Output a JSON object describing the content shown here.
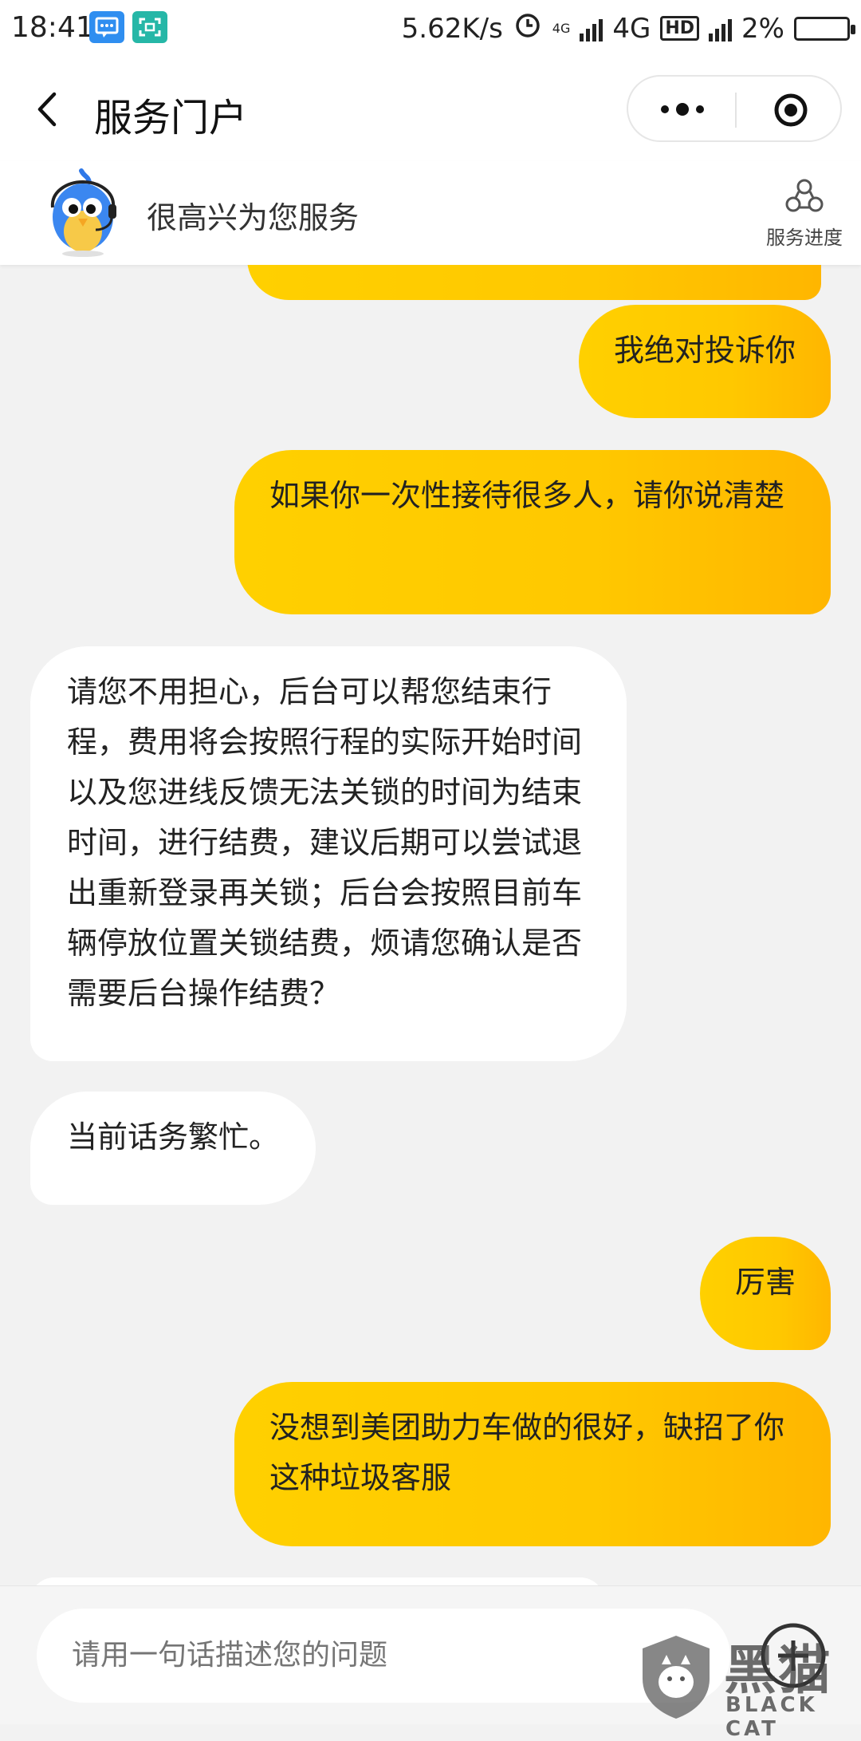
{
  "status_bar": {
    "time": "18:41",
    "speed": "5.62K/s",
    "network_small": "4G",
    "network": "4G",
    "hd": "HD",
    "battery": "2%"
  },
  "titlebar": {
    "title": "服务门户"
  },
  "header": {
    "greeting": "很高兴为您服务",
    "progress_label": "服务进度"
  },
  "messages": [
    {
      "role": "user",
      "text": "我绝对投诉你"
    },
    {
      "role": "user",
      "text": "如果你一次性接待很多人，请你说清楚"
    },
    {
      "role": "agent",
      "text": "请您不用担心，后台可以帮您结束行程，费用将会按照行程的实际开始时间以及您进线反馈无法关锁的时间为结束时间，进行结费，建议后期可以尝试退出重新登录再关锁；后台会按照目前车辆停放位置关锁结费，烦请您确认是否需要后台操作结费？"
    },
    {
      "role": "agent",
      "text": "当前话务繁忙。"
    },
    {
      "role": "user",
      "text": "厉害"
    },
    {
      "role": "user",
      "text": "没想到美团助力车做的很好，缺招了你这种垃圾客服"
    }
  ],
  "input": {
    "placeholder": "请用一句话描述您的问题"
  },
  "watermark": {
    "cn": "黑猫",
    "en": "BLACK CAT"
  },
  "colors": {
    "user_bubble": "#ffc800",
    "agent_bubble": "#ffffff",
    "background": "#f2f2f2"
  }
}
